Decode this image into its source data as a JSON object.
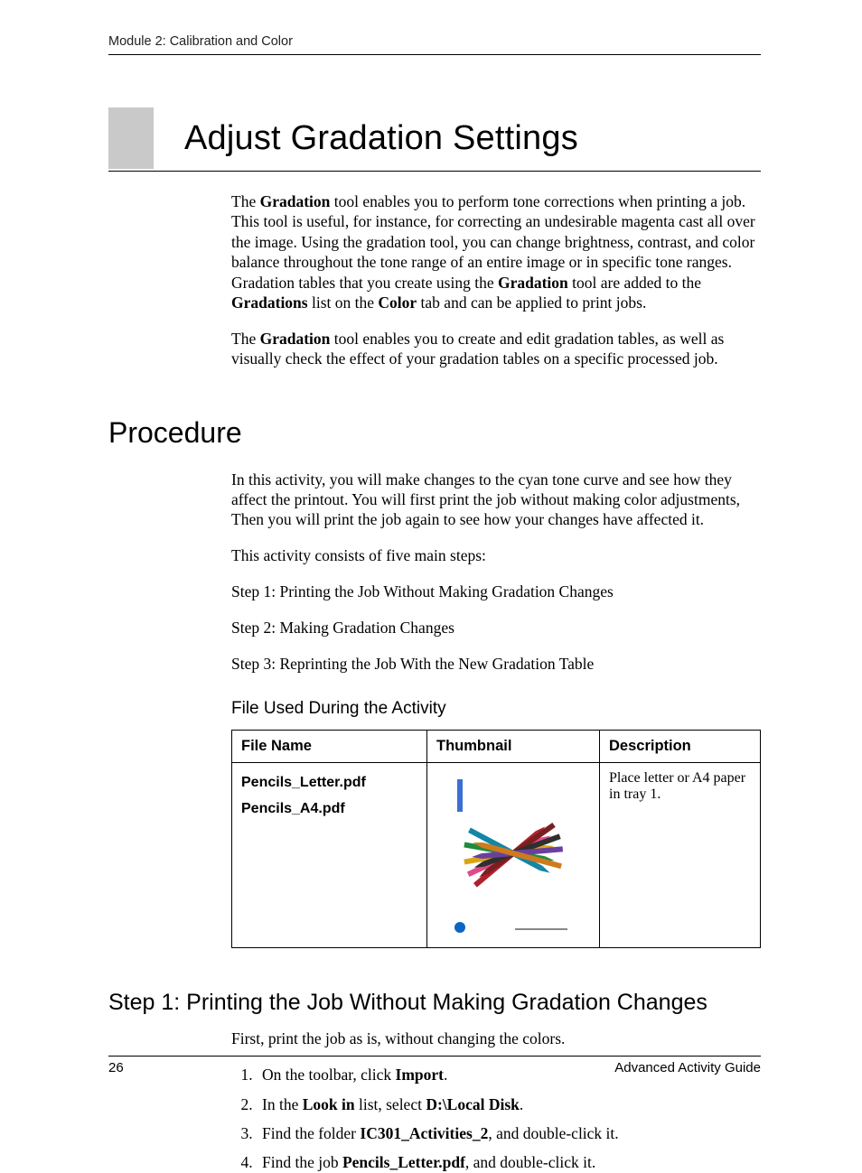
{
  "running_head": "Module 2: Calibration and Color",
  "title": "Adjust Gradation Settings",
  "intro": {
    "p1_a": "The ",
    "p1_b": "Gradation",
    "p1_c": " tool enables you to perform tone corrections when printing a job. This tool is useful, for instance, for correcting an undesirable magenta cast all over the image. Using the gradation tool, you can change brightness, contrast, and color balance throughout the tone range of an entire image or in specific tone ranges. Gradation tables that you create using the ",
    "p1_d": "Gradation",
    "p1_e": " tool are added to the ",
    "p1_f": "Gradations",
    "p1_g": " list on the ",
    "p1_h": "Color",
    "p1_i": " tab and can be applied to print jobs.",
    "p2_a": "The ",
    "p2_b": "Gradation",
    "p2_c": " tool enables you to create and edit gradation tables, as well as visually check the effect of your gradation tables on a specific processed job."
  },
  "procedure": {
    "heading": "Procedure",
    "p1": "In this activity, you will make changes to the cyan tone curve and see how they affect the printout. You will first print the job without making color adjustments, Then you will print the job again to see how your changes have affected it.",
    "p2": "This activity consists of five main steps:",
    "steps": [
      "Step 1: Printing the Job Without Making Gradation Changes",
      "Step 2: Making Gradation Changes",
      "Step 3: Reprinting the Job With the New Gradation Table"
    ]
  },
  "file_section": {
    "heading": "File Used During the Activity",
    "headers": {
      "c1": "File Name",
      "c2": "Thumbnail",
      "c3": "Description"
    },
    "row": {
      "name1": "Pencils_Letter.pdf",
      "name2": "Pencils_A4.pdf",
      "desc": "Place letter or A4 paper in tray 1."
    }
  },
  "step1": {
    "heading": "Step 1: Printing the Job Without Making Gradation Changes",
    "lead": "First, print the job as is, without changing the colors.",
    "items": {
      "i1a": "On the toolbar, click ",
      "i1b": "Import",
      "i1c": ".",
      "i2a": "In the ",
      "i2b": "Look in",
      "i2c": " list, select ",
      "i2d": "D:\\Local Disk",
      "i2e": ".",
      "i3a": "Find the folder ",
      "i3b": "IC301_Activities_2",
      "i3c": ", and double-click it.",
      "i4a": "Find the job ",
      "i4b": "Pencils_Letter.pdf",
      "i4c": ", and double-click it."
    }
  },
  "footer": {
    "page": "26",
    "guide": "Advanced Activity Guide"
  }
}
